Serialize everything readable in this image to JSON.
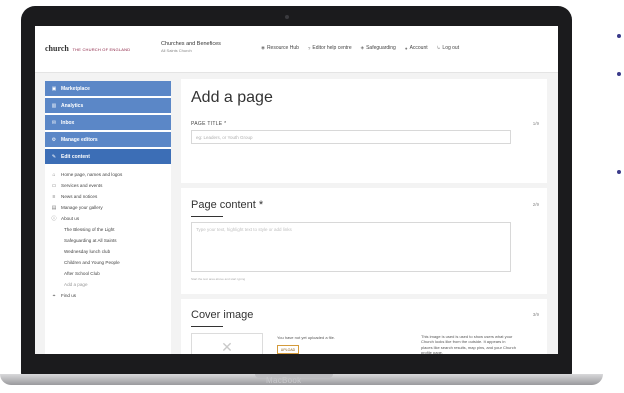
{
  "device": {
    "brand": "MacBook"
  },
  "header": {
    "logo_mark": "church",
    "logo_sub": "THE CHURCH OF ENGLAND",
    "church_name": "Churches and Benefices",
    "church_sub": "All Saints Church",
    "nav": [
      {
        "label": "Resource Hub",
        "icon": "rss-icon"
      },
      {
        "label": "Editor help centre",
        "icon": "question-icon"
      },
      {
        "label": "Safeguarding",
        "icon": "shield-icon"
      },
      {
        "label": "Account",
        "icon": "user-icon"
      },
      {
        "label": "Log out",
        "icon": "logout-icon"
      }
    ]
  },
  "sidebar": {
    "menu": [
      {
        "label": "Marketplace",
        "icon": "shop-icon"
      },
      {
        "label": "Analytics",
        "icon": "chart-icon"
      },
      {
        "label": "Inbox",
        "icon": "mail-icon"
      },
      {
        "label": "Manage editors",
        "icon": "gear-icon"
      },
      {
        "label": "Edit content",
        "icon": "pencil-icon"
      }
    ],
    "items": [
      {
        "label": "Home page, names and logos",
        "icon": "home-icon"
      },
      {
        "label": "Services and events",
        "icon": "calendar-icon"
      },
      {
        "label": "News and notices",
        "icon": "news-icon"
      },
      {
        "label": "Manage your gallery",
        "icon": "gallery-icon"
      },
      {
        "label": "About us",
        "icon": "info-icon"
      }
    ],
    "children": [
      "The Blessing of the Light",
      "Safeguarding at All Saints",
      "Wednesday lunch club",
      "Children and Young People",
      "After School Club",
      "Add a page"
    ],
    "bottom_item": "Find us"
  },
  "main": {
    "title": "Add a page",
    "page_title_label": "PAGE TITLE *",
    "page_title_counter": "1/9",
    "page_title_placeholder": "eg: Leaders, or Youth Group",
    "content_heading": "Page content *",
    "content_counter": "2/9",
    "content_placeholder": "Type your text, highlight text to style or add links",
    "content_hint": "Start the text area above and start typing",
    "cover_heading": "Cover image",
    "cover_counter": "3/9",
    "upload_text": "You have not yet uploaded a file.",
    "upload_button": "UPLOAD",
    "cover_help": "This image is used is used to show users what your Church looks like from the outside. It appears in places like search results, map pins, and your Church profile page."
  }
}
